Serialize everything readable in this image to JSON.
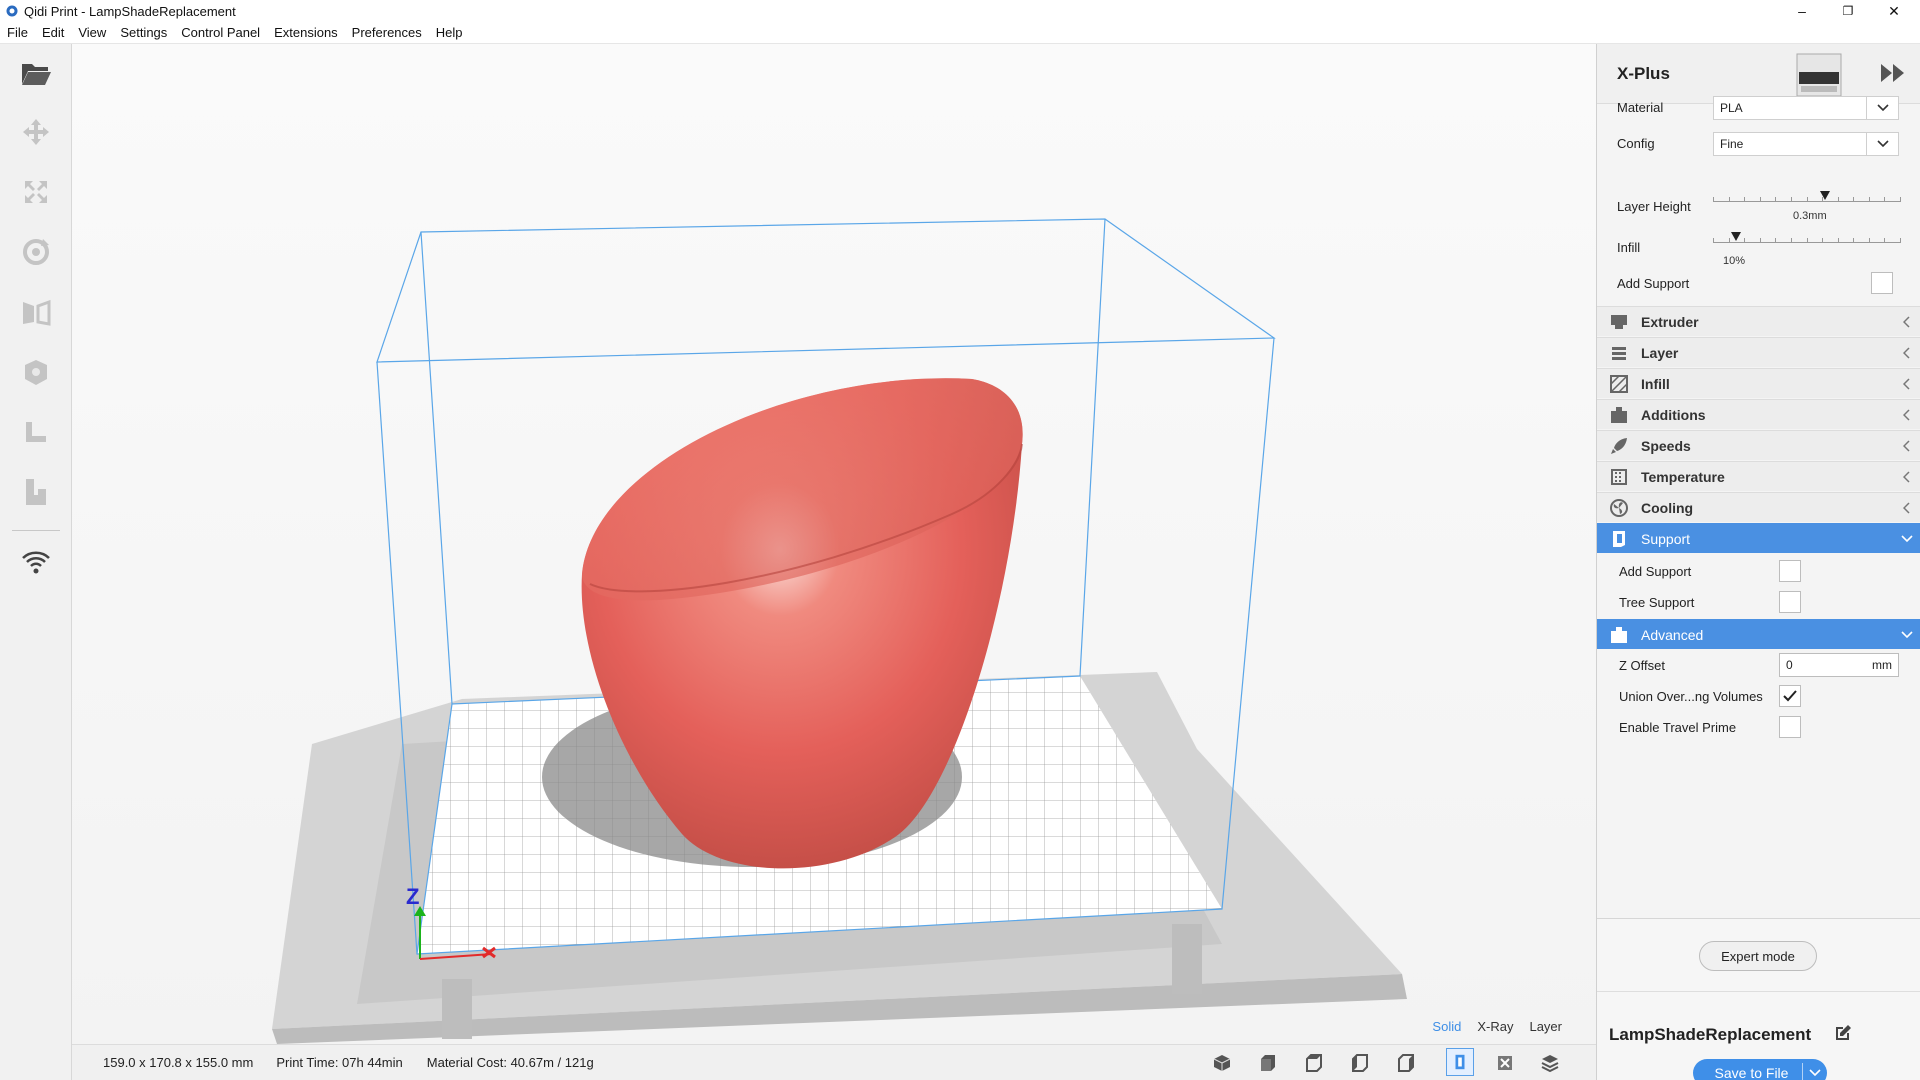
{
  "window": {
    "title": "Qidi Print - LampShadeReplacement",
    "minimize": "–",
    "maximize": "❐",
    "close": "✕"
  },
  "menu": [
    "File",
    "Edit",
    "View",
    "Settings",
    "Control Panel",
    "Extensions",
    "Preferences",
    "Help"
  ],
  "toolbar": {
    "tools": [
      "open-file-icon",
      "move-icon",
      "scale-icon",
      "rotate-icon",
      "mirror-icon",
      "per-model-settings-icon",
      "support-blocker-icon",
      "lay-flat-icon",
      "wifi-icon"
    ]
  },
  "viewport": {
    "axis_z": "Z",
    "view_modes": [
      "Solid",
      "X-Ray",
      "Layer"
    ],
    "active_view_mode": "Solid",
    "model_color": "#e8645a",
    "build_volume_color": "#5aa6e8"
  },
  "status": {
    "dimensions": "159.0 x 170.8 x 155.0 mm",
    "print_time": "Print Time: 07h 44min",
    "material_cost": "Material Cost: 40.67m / 121g"
  },
  "camera_buttons": [
    "3d-view-icon",
    "front-view-icon",
    "top-view-icon",
    "left-view-icon",
    "right-view-icon",
    "support-view-icon",
    "xray-view-icon",
    "layer-view-icon"
  ],
  "panel": {
    "printer_name": "X-Plus",
    "material_label": "Material",
    "material_value": "PLA",
    "config_label": "Config",
    "config_value": "Fine",
    "layer_height_label": "Layer Height",
    "layer_height_value": "0.3mm",
    "layer_height_fraction": 0.6,
    "infill_label": "Infill",
    "infill_value": "10%",
    "infill_fraction": 0.1,
    "add_support_label": "Add Support",
    "sections": [
      {
        "label": "Extruder",
        "icon": "extruder-icon"
      },
      {
        "label": "Layer",
        "icon": "layer-icon"
      },
      {
        "label": "Infill",
        "icon": "infill-icon"
      },
      {
        "label": "Additions",
        "icon": "additions-icon"
      },
      {
        "label": "Speeds",
        "icon": "speeds-icon"
      },
      {
        "label": "Temperature",
        "icon": "temperature-icon"
      },
      {
        "label": "Cooling",
        "icon": "cooling-icon"
      }
    ],
    "support_section": {
      "label": "Support",
      "add_support": "Add Support",
      "tree_support": "Tree Support"
    },
    "advanced_section": {
      "label": "Advanced",
      "z_offset_label": "Z Offset",
      "z_offset_value": "0",
      "z_offset_unit": "mm",
      "union_label": "Union Over...ng Volumes",
      "union_checked": true,
      "travel_prime_label": "Enable Travel Prime",
      "travel_prime_checked": false
    },
    "expert_mode": "Expert mode",
    "job_name": "LampShadeReplacement",
    "save_button": "Save to File",
    "accent_color": "#4a90e2"
  }
}
